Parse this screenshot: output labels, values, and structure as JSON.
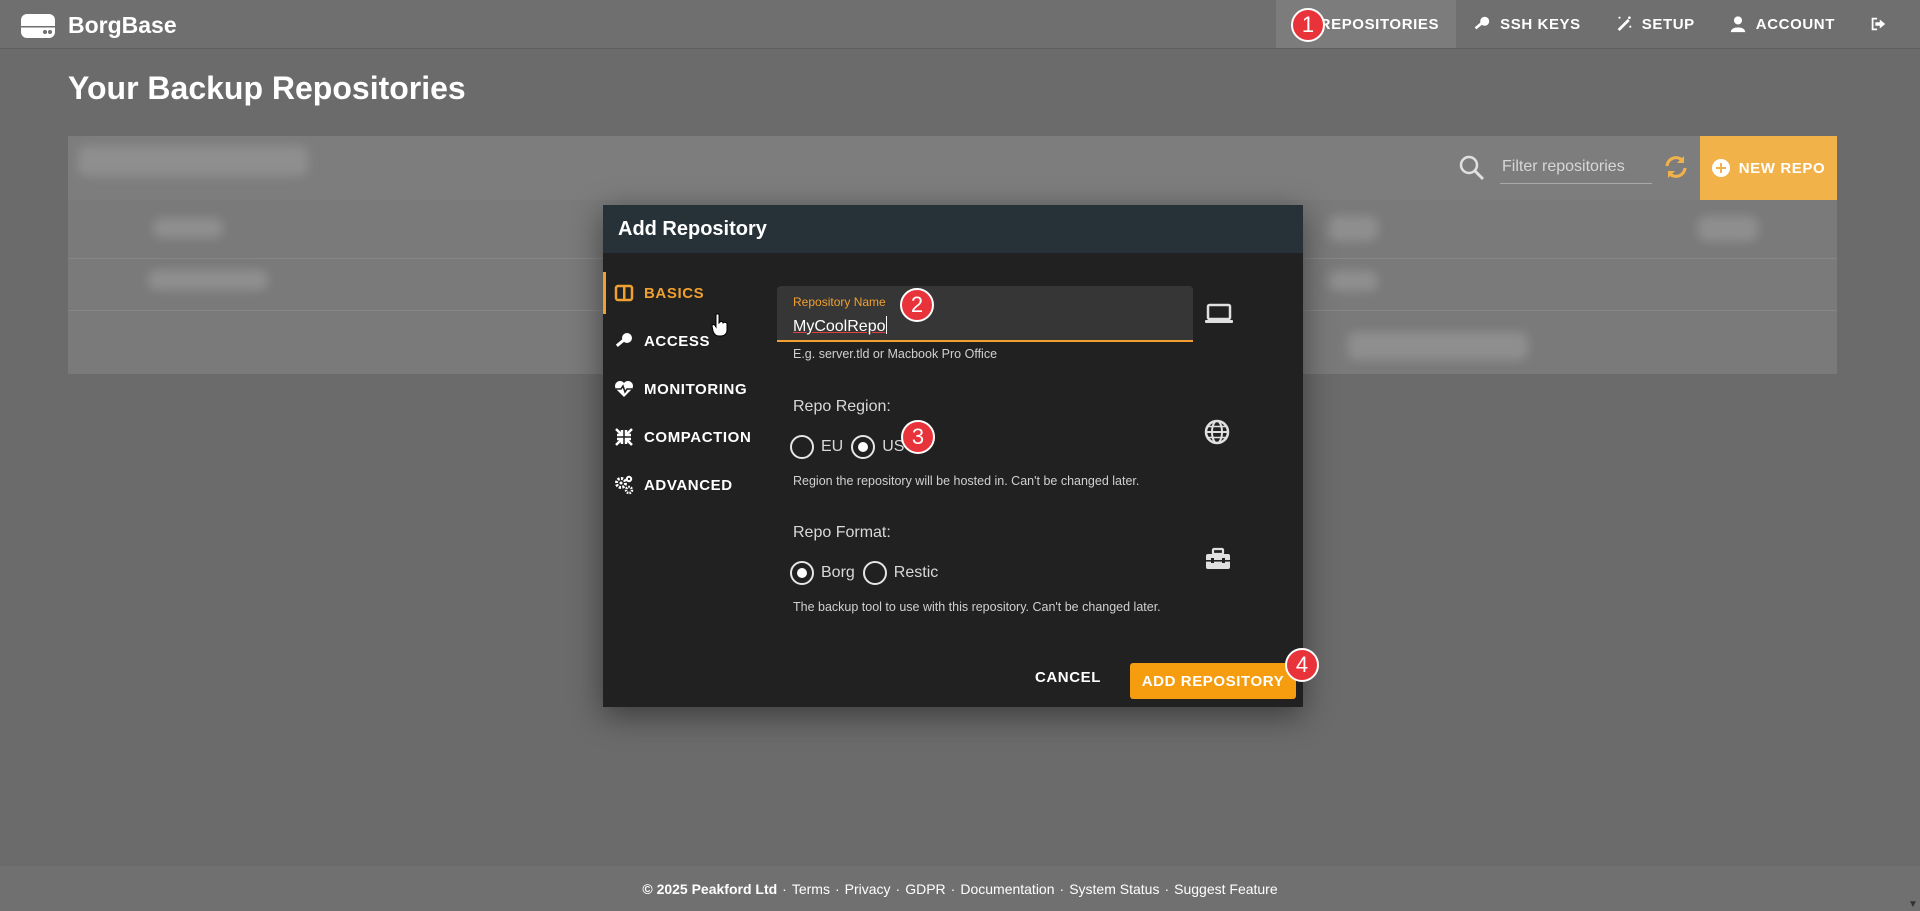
{
  "header": {
    "brand": "BorgBase",
    "nav": [
      {
        "label": "REPOSITORIES",
        "icon": "server-icon"
      },
      {
        "label": "SSH KEYS",
        "icon": "key-icon"
      },
      {
        "label": "SETUP",
        "icon": "magic-wand-icon"
      },
      {
        "label": "ACCOUNT",
        "icon": "user-icon"
      }
    ]
  },
  "page": {
    "title": "Your Backup Repositories",
    "filter_placeholder": "Filter repositories",
    "new_repo_label": "NEW REPO"
  },
  "modal": {
    "title": "Add Repository",
    "sidebar": [
      {
        "label": "BASICS",
        "icon": "columns-icon"
      },
      {
        "label": "ACCESS",
        "icon": "key-icon"
      },
      {
        "label": "MONITORING",
        "icon": "heartbeat-icon"
      },
      {
        "label": "COMPACTION",
        "icon": "compress-icon"
      },
      {
        "label": "ADVANCED",
        "icon": "cogs-icon"
      }
    ],
    "name_field": {
      "label": "Repository Name",
      "value": "MyCoolRepo",
      "hint": "E.g. server.tld or Macbook Pro Office"
    },
    "region": {
      "label": "Repo Region:",
      "options": [
        "EU",
        "US"
      ],
      "selected": "US",
      "hint": "Region the repository will be hosted in. Can't be changed later."
    },
    "format": {
      "label": "Repo Format:",
      "options": [
        "Borg",
        "Restic"
      ],
      "selected": "Borg",
      "hint": "The backup tool to use with this repository. Can't be changed later."
    },
    "cancel_label": "CANCEL",
    "submit_label": "ADD REPOSITORY"
  },
  "badges": [
    "1",
    "2",
    "3",
    "4"
  ],
  "footer": {
    "copyright": "© 2025 Peakford Ltd",
    "links": [
      "Terms",
      "Privacy",
      "GDPR",
      "Documentation",
      "System Status",
      "Suggest Feature"
    ]
  },
  "colors": {
    "accent": "#f0a030",
    "button": "#f59c0f",
    "modal_header": "#263238",
    "badge": "#e8333a"
  }
}
